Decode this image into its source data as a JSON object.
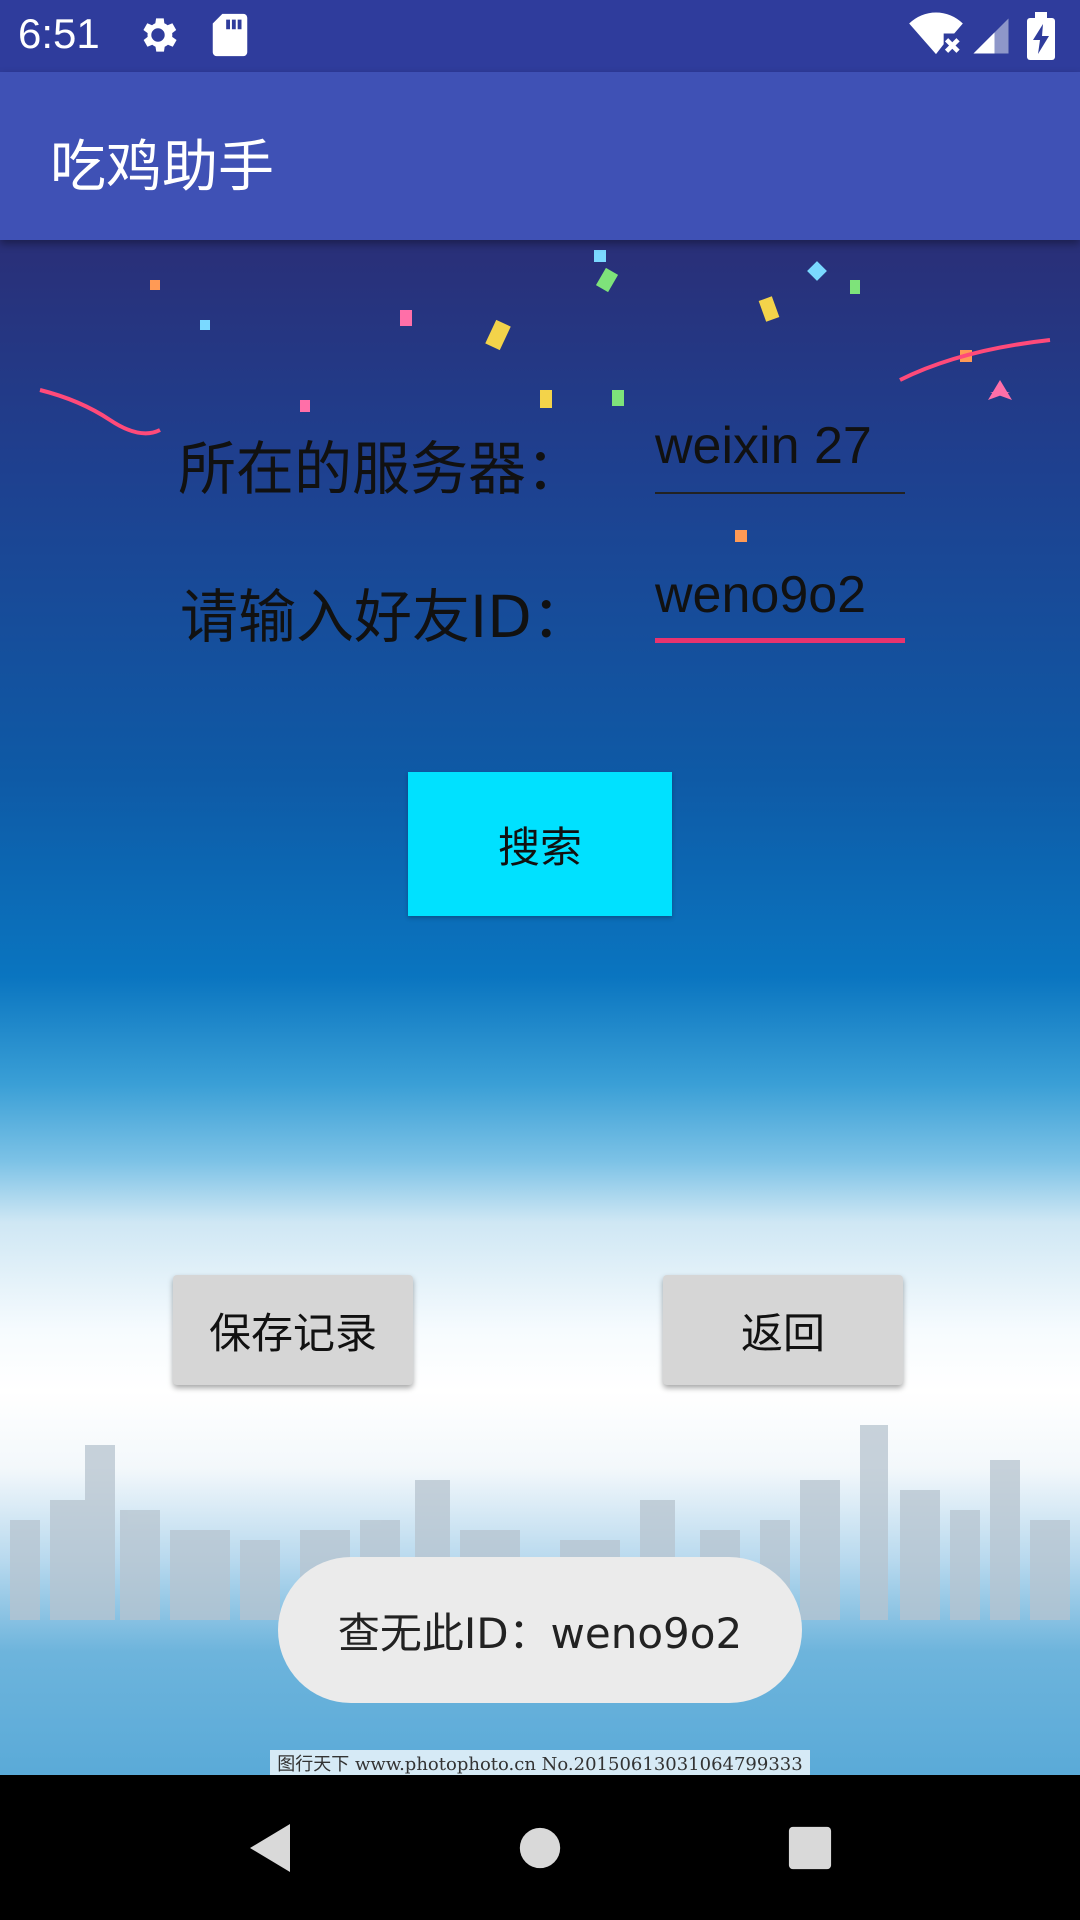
{
  "status_bar": {
    "time": "6:51",
    "icons": [
      "gear-icon",
      "sd-card-icon",
      "wifi-off-icon",
      "signal-icon",
      "battery-charging-icon"
    ]
  },
  "app_bar": {
    "title": "吃鸡助手"
  },
  "form": {
    "server_label": "所在的服务器：",
    "server_value": "weixin 27",
    "friend_label": "请输入好友ID：",
    "friend_value": "weno9o2"
  },
  "buttons": {
    "search": "搜索",
    "save": "保存记录",
    "back": "返回"
  },
  "toast": {
    "message": "查无此ID：weno9o2"
  },
  "background": {
    "watermark": "图行天下 www.photophoto.cn No.20150613031064799333"
  },
  "colors": {
    "status_bar": "#2f3c9c",
    "app_bar": "#3f51b5",
    "search_button": "#00e1ff",
    "field_underline_active": "#e8336e",
    "secondary_button": "#d6d6d6"
  },
  "nav_bar": {
    "icons": [
      "back-icon",
      "home-icon",
      "recents-icon"
    ]
  }
}
